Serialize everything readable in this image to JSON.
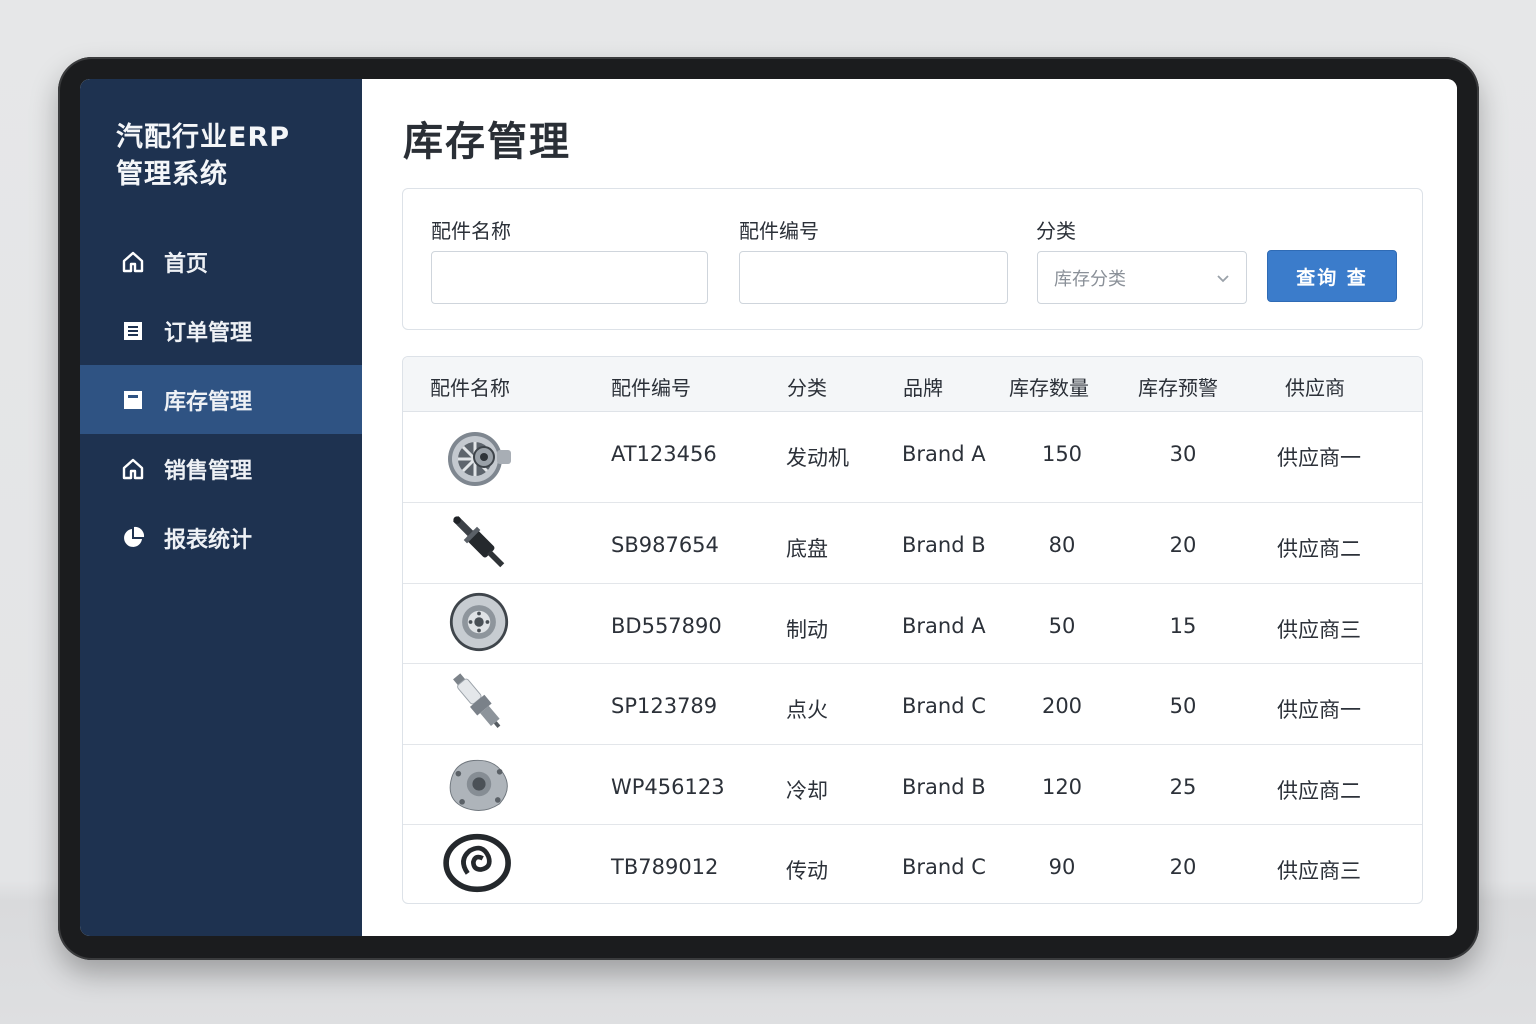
{
  "app": {
    "title": "汽配行业ERP\n管理系统"
  },
  "sidebar": {
    "items": [
      {
        "label": "首页",
        "icon": "home-icon",
        "active": false
      },
      {
        "label": "订单管理",
        "icon": "document-list-icon",
        "active": false
      },
      {
        "label": "库存管理",
        "icon": "inventory-box-icon",
        "active": true
      },
      {
        "label": "销售管理",
        "icon": "home-icon",
        "active": false
      },
      {
        "label": "报表统计",
        "icon": "pie-chart-icon",
        "active": false
      }
    ]
  },
  "page": {
    "title": "库存管理"
  },
  "filters": {
    "name_label": "配件名称",
    "name_value": "",
    "code_label": "配件编号",
    "code_value": "",
    "category_label": "分类",
    "category_selected": "库存分类",
    "search_label": "查询 查"
  },
  "table": {
    "headers": [
      "配件名称",
      "配件编号",
      "分类",
      "品牌",
      "库存数量",
      "库存预警",
      "供应商"
    ],
    "rows": [
      {
        "image": "alternator-part-image",
        "code": "AT123456",
        "category": "发动机",
        "brand": "Brand A",
        "qty": "150",
        "alert": "30",
        "supplier": "供应商一"
      },
      {
        "image": "shock-absorber-part-image",
        "code": "SB987654",
        "category": "底盘",
        "brand": "Brand B",
        "qty": "80",
        "alert": "20",
        "supplier": "供应商二"
      },
      {
        "image": "brake-disc-part-image",
        "code": "BD557890",
        "category": "制动",
        "brand": "Brand A",
        "qty": "50",
        "alert": "15",
        "supplier": "供应商三"
      },
      {
        "image": "spark-plug-part-image",
        "code": "SP123789",
        "category": "点火",
        "brand": "Brand C",
        "qty": "200",
        "alert": "50",
        "supplier": "供应商一"
      },
      {
        "image": "water-pump-part-image",
        "code": "WP456123",
        "category": "冷却",
        "brand": "Brand B",
        "qty": "120",
        "alert": "25",
        "supplier": "供应商二"
      },
      {
        "image": "timing-belt-part-image",
        "code": "TB789012",
        "category": "传动",
        "brand": "Brand C",
        "qty": "90",
        "alert": "20",
        "supplier": "供应商三"
      }
    ]
  },
  "colors": {
    "sidebar_bg": "#1e3250",
    "sidebar_active": "#2f5383",
    "primary_button": "#3b7ccb"
  }
}
